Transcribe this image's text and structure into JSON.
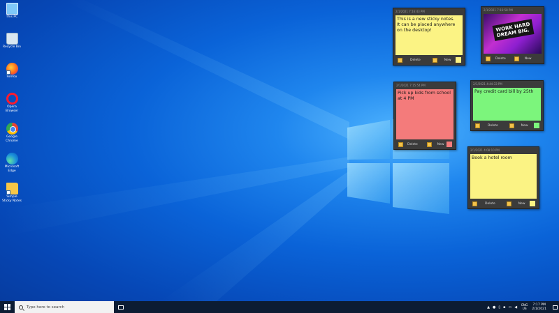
{
  "desktop_icons": [
    {
      "label": "This PC",
      "icon": "pc-icon"
    },
    {
      "label": "Recycle Bin",
      "icon": "recycle-bin-icon"
    },
    {
      "label": "Firefox",
      "icon": "firefox-icon"
    },
    {
      "label": "Opera Browser",
      "icon": "opera-icon"
    },
    {
      "label": "Google Chrome",
      "icon": "chrome-icon"
    },
    {
      "label": "Microsoft Edge",
      "icon": "edge-icon"
    },
    {
      "label": "Simple Sticky Notes",
      "icon": "folder-icon"
    }
  ],
  "notes": [
    {
      "id": "note1",
      "color": "yellow",
      "timestamp": "2/1/2021 7:16:43 PM",
      "text": "This is a new sticky notes.\nIt can be placed anywhere on the desktop!",
      "delete_label": "Delete",
      "new_label": "New"
    },
    {
      "id": "note2",
      "color": "image",
      "timestamp": "2/1/2021 7:16:58 PM",
      "image_text": "WORK HARD\nDREAM BIG.",
      "delete_label": "Delete",
      "new_label": "New"
    },
    {
      "id": "note3",
      "color": "red",
      "timestamp": "2/1/2021 7:15:54 PM",
      "text": "Pick up kids from school at 4 PM",
      "delete_label": "Delete",
      "new_label": "New"
    },
    {
      "id": "note4",
      "color": "green",
      "timestamp": "2/1/2021 4:44:33 PM",
      "text": "Pay credit card bill by 25th",
      "delete_label": "Delete",
      "new_label": "New"
    },
    {
      "id": "note5",
      "color": "yellow",
      "timestamp": "2/1/2021 4:08:10 PM",
      "text": "Book a hotel room",
      "delete_label": "Delete",
      "new_label": "New"
    }
  ],
  "colors": {
    "yellow": "#fbf384",
    "red": "#f47b7b",
    "green": "#7cf57c",
    "note_frame": "#3b3b3b"
  },
  "taskbar": {
    "search_placeholder": "Type here to search",
    "language_top": "ENG",
    "language_bottom": "US",
    "time": "7:17 PM",
    "date": "2/1/2021"
  }
}
